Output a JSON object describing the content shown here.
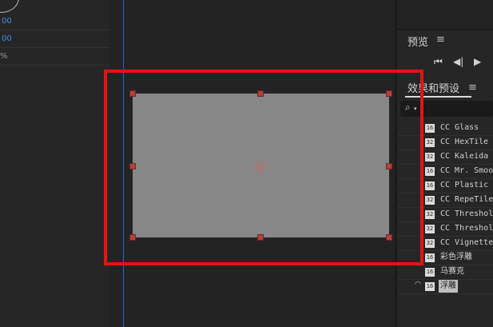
{
  "properties": [
    {
      "value": "00",
      "kind": "blue"
    },
    {
      "value": "00",
      "kind": "blue"
    },
    {
      "value": "%",
      "kind": "pct"
    }
  ],
  "preview_panel": {
    "title": "预览",
    "menu": "≡",
    "controls": [
      "⏮",
      "◀|",
      "▶"
    ]
  },
  "effects_panel": {
    "title": "效果和预设",
    "menu": "≡",
    "search_icon": "⌕",
    "search_caret": "▾"
  },
  "effects": [
    {
      "badge": "16",
      "name": "CC Glass"
    },
    {
      "badge": "32",
      "name": "CC HexTile"
    },
    {
      "badge": "32",
      "name": "CC Kaleida"
    },
    {
      "badge": "16",
      "name": "CC Mr. Smoothie"
    },
    {
      "badge": "16",
      "name": "CC Plastic"
    },
    {
      "badge": "32",
      "name": "CC RepeTile"
    },
    {
      "badge": "32",
      "name": "CC Threshold"
    },
    {
      "badge": "32",
      "name": "CC Threshold RGB"
    },
    {
      "badge": "32",
      "name": "CC Vignette"
    },
    {
      "badge": "16",
      "name": "彩色浮雕"
    },
    {
      "badge": "16",
      "name": "马赛克"
    },
    {
      "badge": "16",
      "name": "浮雕",
      "selected": true
    }
  ],
  "colors": {
    "highlight": "#e21414",
    "handle": "#b2413e",
    "layer": "#878787",
    "timeline": "#2f5fd8"
  }
}
